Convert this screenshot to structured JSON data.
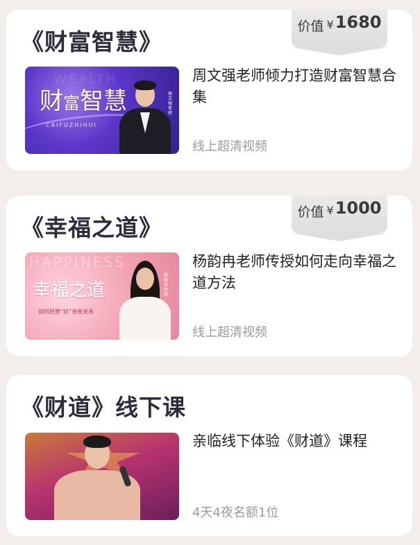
{
  "courses": [
    {
      "title": "《财富智慧》",
      "price_label": "价值",
      "price_currency": "¥",
      "price_value": "1680",
      "description": "周文强老师倾力打造财富智慧合集",
      "meta": "线上超清视频",
      "thumb": {
        "ghost_text": "WEALTH",
        "big_text_1": "财",
        "big_text_2": "富",
        "big_text_3": "智慧",
        "pinyin": "CAIFUZHIHUI",
        "name_tag": "周文强老师"
      }
    },
    {
      "title": "《幸福之道》",
      "price_label": "价值",
      "price_currency": "¥",
      "price_value": "1000",
      "description": "杨韵冉老师传授如何走向幸福之道方法",
      "meta": "线上超清视频",
      "thumb": {
        "ghost_text": "HAPPINESS",
        "big_text": "幸福之道",
        "subtitle": "如何经营“好”亲密关系",
        "name_tag": "杨韵冉老师"
      }
    },
    {
      "title": "《财道》线下课",
      "description": "亲临线下体验《财道》课程",
      "meta": "4天4夜名额1位"
    }
  ],
  "colors": {
    "background": "#f3eeea",
    "card": "#ffffff",
    "title": "#2f2b3a",
    "meta": "#9a9a9a",
    "price_tag": "#dfdedd"
  }
}
